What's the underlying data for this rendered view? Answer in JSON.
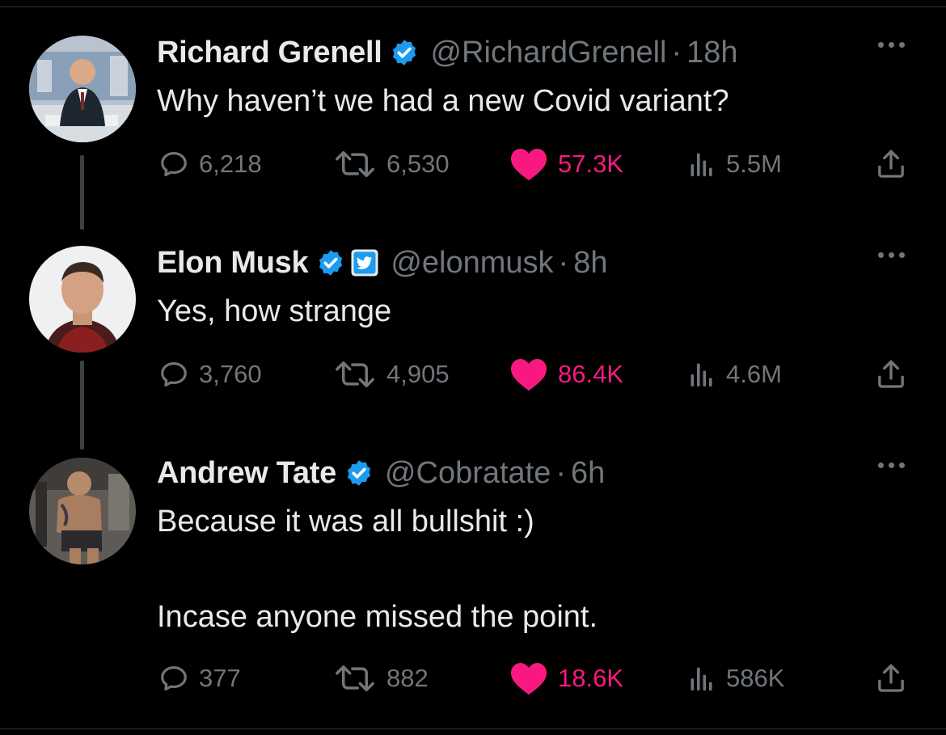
{
  "tweets": [
    {
      "name": "Richard Grenell",
      "handle": "@RichardGrenell",
      "dot": "·",
      "time": "18h",
      "lines": [
        "Why haven’t we had a new Covid variant?"
      ],
      "replies": "6,218",
      "retweets": "6,530",
      "likes": "57.3K",
      "views": "5.5M"
    },
    {
      "name": "Elon Musk",
      "handle": "@elonmusk",
      "dot": "·",
      "time": "8h",
      "lines": [
        "Yes, how strange"
      ],
      "replies": "3,760",
      "retweets": "4,905",
      "likes": "86.4K",
      "views": "4.6M"
    },
    {
      "name": "Andrew Tate",
      "handle": "@Cobratate",
      "dot": "·",
      "time": "6h",
      "lines": [
        "Because it was all bullshit :)",
        "Incase anyone missed the point."
      ],
      "replies": "377",
      "retweets": "882",
      "likes": "18.6K",
      "views": "586K"
    }
  ],
  "icons": {
    "verified": "verified-badge-icon",
    "affiliate": "twitter-bird-icon",
    "reply": "reply-icon",
    "retweet": "retweet-icon",
    "like": "heart-icon",
    "views": "views-icon",
    "share": "share-icon",
    "more": "more-icon"
  },
  "colors": {
    "background": "#000000",
    "text": "#e7e9ea",
    "muted": "#71767b",
    "like": "#f91880",
    "verified": "#1d9bf0"
  }
}
